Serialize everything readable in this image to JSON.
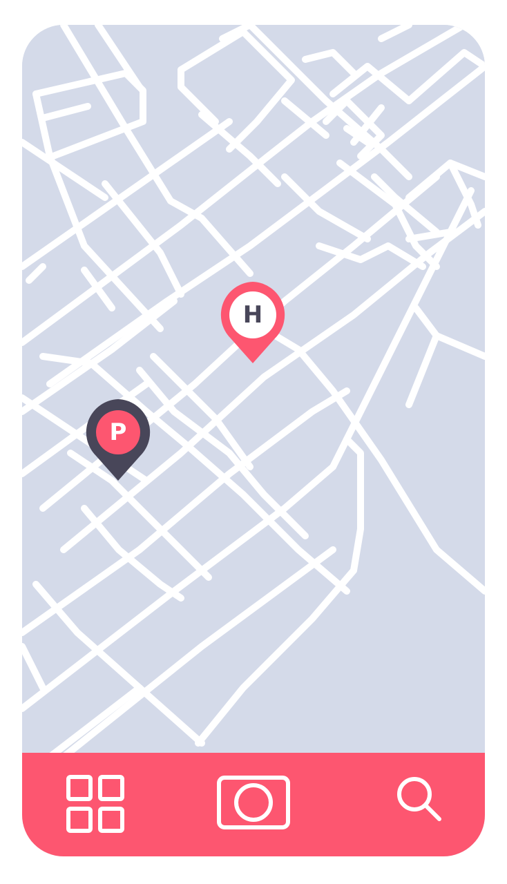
{
  "theme": {
    "map_background": "#d4dae9",
    "road_color": "#ffffff",
    "accent": "#fd5670",
    "dark_pin": "#484659",
    "tabbar_background": "#fd5670",
    "tab_icon_color": "#ffffff"
  },
  "map": {
    "markers": [
      {
        "id": "hotel",
        "letter": "H",
        "pin_color": "#fd5670",
        "badge_color": "#ffffff",
        "letter_color": "#484659"
      },
      {
        "id": "parking",
        "letter": "P",
        "pin_color": "#484659",
        "badge_color": "#fd5670",
        "letter_color": "#ffffff"
      }
    ]
  },
  "tabbar": {
    "items": [
      {
        "id": "grid",
        "icon": "grid-icon"
      },
      {
        "id": "camera",
        "icon": "camera-icon"
      },
      {
        "id": "search",
        "icon": "search-icon"
      }
    ]
  }
}
